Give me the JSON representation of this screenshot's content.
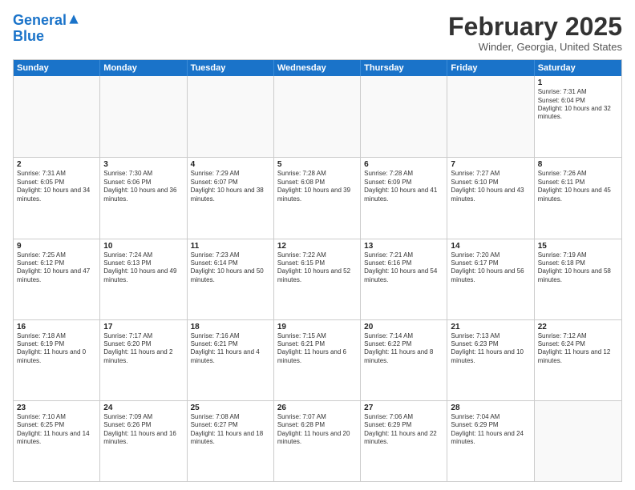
{
  "logo": {
    "line1": "General",
    "line2": "Blue"
  },
  "title": "February 2025",
  "subtitle": "Winder, Georgia, United States",
  "days_of_week": [
    "Sunday",
    "Monday",
    "Tuesday",
    "Wednesday",
    "Thursday",
    "Friday",
    "Saturday"
  ],
  "weeks": [
    [
      {
        "day": "",
        "info": ""
      },
      {
        "day": "",
        "info": ""
      },
      {
        "day": "",
        "info": ""
      },
      {
        "day": "",
        "info": ""
      },
      {
        "day": "",
        "info": ""
      },
      {
        "day": "",
        "info": ""
      },
      {
        "day": "1",
        "info": "Sunrise: 7:31 AM\nSunset: 6:04 PM\nDaylight: 10 hours and 32 minutes."
      }
    ],
    [
      {
        "day": "2",
        "info": "Sunrise: 7:31 AM\nSunset: 6:05 PM\nDaylight: 10 hours and 34 minutes."
      },
      {
        "day": "3",
        "info": "Sunrise: 7:30 AM\nSunset: 6:06 PM\nDaylight: 10 hours and 36 minutes."
      },
      {
        "day": "4",
        "info": "Sunrise: 7:29 AM\nSunset: 6:07 PM\nDaylight: 10 hours and 38 minutes."
      },
      {
        "day": "5",
        "info": "Sunrise: 7:28 AM\nSunset: 6:08 PM\nDaylight: 10 hours and 39 minutes."
      },
      {
        "day": "6",
        "info": "Sunrise: 7:28 AM\nSunset: 6:09 PM\nDaylight: 10 hours and 41 minutes."
      },
      {
        "day": "7",
        "info": "Sunrise: 7:27 AM\nSunset: 6:10 PM\nDaylight: 10 hours and 43 minutes."
      },
      {
        "day": "8",
        "info": "Sunrise: 7:26 AM\nSunset: 6:11 PM\nDaylight: 10 hours and 45 minutes."
      }
    ],
    [
      {
        "day": "9",
        "info": "Sunrise: 7:25 AM\nSunset: 6:12 PM\nDaylight: 10 hours and 47 minutes."
      },
      {
        "day": "10",
        "info": "Sunrise: 7:24 AM\nSunset: 6:13 PM\nDaylight: 10 hours and 49 minutes."
      },
      {
        "day": "11",
        "info": "Sunrise: 7:23 AM\nSunset: 6:14 PM\nDaylight: 10 hours and 50 minutes."
      },
      {
        "day": "12",
        "info": "Sunrise: 7:22 AM\nSunset: 6:15 PM\nDaylight: 10 hours and 52 minutes."
      },
      {
        "day": "13",
        "info": "Sunrise: 7:21 AM\nSunset: 6:16 PM\nDaylight: 10 hours and 54 minutes."
      },
      {
        "day": "14",
        "info": "Sunrise: 7:20 AM\nSunset: 6:17 PM\nDaylight: 10 hours and 56 minutes."
      },
      {
        "day": "15",
        "info": "Sunrise: 7:19 AM\nSunset: 6:18 PM\nDaylight: 10 hours and 58 minutes."
      }
    ],
    [
      {
        "day": "16",
        "info": "Sunrise: 7:18 AM\nSunset: 6:19 PM\nDaylight: 11 hours and 0 minutes."
      },
      {
        "day": "17",
        "info": "Sunrise: 7:17 AM\nSunset: 6:20 PM\nDaylight: 11 hours and 2 minutes."
      },
      {
        "day": "18",
        "info": "Sunrise: 7:16 AM\nSunset: 6:21 PM\nDaylight: 11 hours and 4 minutes."
      },
      {
        "day": "19",
        "info": "Sunrise: 7:15 AM\nSunset: 6:21 PM\nDaylight: 11 hours and 6 minutes."
      },
      {
        "day": "20",
        "info": "Sunrise: 7:14 AM\nSunset: 6:22 PM\nDaylight: 11 hours and 8 minutes."
      },
      {
        "day": "21",
        "info": "Sunrise: 7:13 AM\nSunset: 6:23 PM\nDaylight: 11 hours and 10 minutes."
      },
      {
        "day": "22",
        "info": "Sunrise: 7:12 AM\nSunset: 6:24 PM\nDaylight: 11 hours and 12 minutes."
      }
    ],
    [
      {
        "day": "23",
        "info": "Sunrise: 7:10 AM\nSunset: 6:25 PM\nDaylight: 11 hours and 14 minutes."
      },
      {
        "day": "24",
        "info": "Sunrise: 7:09 AM\nSunset: 6:26 PM\nDaylight: 11 hours and 16 minutes."
      },
      {
        "day": "25",
        "info": "Sunrise: 7:08 AM\nSunset: 6:27 PM\nDaylight: 11 hours and 18 minutes."
      },
      {
        "day": "26",
        "info": "Sunrise: 7:07 AM\nSunset: 6:28 PM\nDaylight: 11 hours and 20 minutes."
      },
      {
        "day": "27",
        "info": "Sunrise: 7:06 AM\nSunset: 6:29 PM\nDaylight: 11 hours and 22 minutes."
      },
      {
        "day": "28",
        "info": "Sunrise: 7:04 AM\nSunset: 6:29 PM\nDaylight: 11 hours and 24 minutes."
      },
      {
        "day": "",
        "info": ""
      }
    ]
  ]
}
